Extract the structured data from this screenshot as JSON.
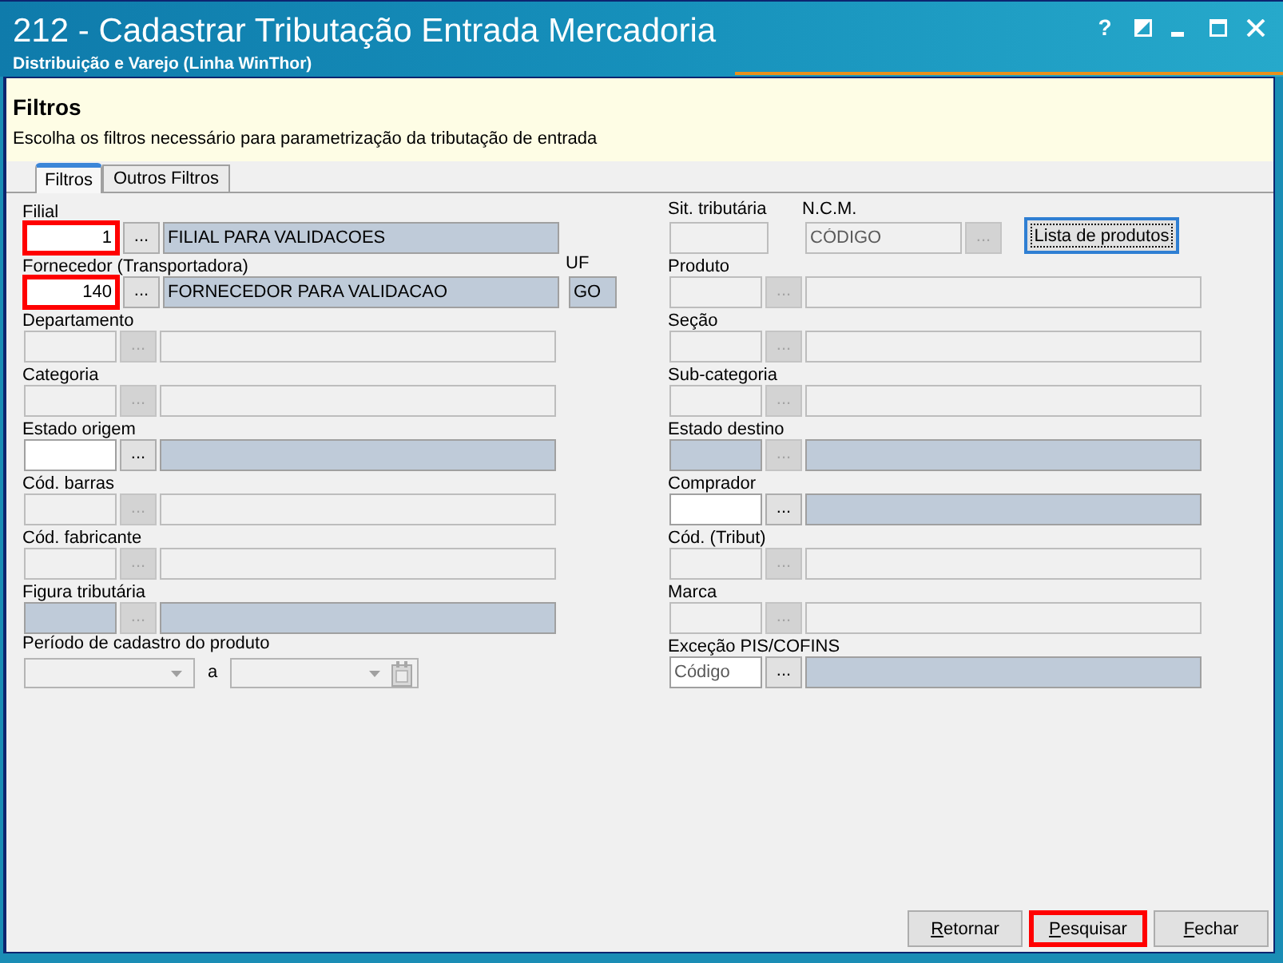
{
  "window": {
    "title": "212 - Cadastrar Tributação Entrada Mercadoria",
    "subtitle": "Distribuição e Varejo (Linha WinThor)",
    "help_button": "?"
  },
  "header": {
    "title": "Filtros",
    "description": "Escolha os filtros necessário para parametrização da tributação de entrada"
  },
  "tabs": [
    {
      "label": "Filtros",
      "selected": true
    },
    {
      "label": "Outros Filtros",
      "selected": false
    }
  ],
  "left_column": [
    {
      "kind": "lookup",
      "label": "Filial",
      "code": {
        "value": "1",
        "readonly": false,
        "disabled": false,
        "highlighted": true
      },
      "button": {
        "label": "...",
        "disabled": false
      },
      "description": {
        "value": "FILIAL PARA VALIDACOES",
        "readonly": true,
        "disabled": false
      }
    },
    {
      "kind": "lookup",
      "label": "Fornecedor (Transportadora)",
      "code": {
        "value": "140",
        "readonly": false,
        "disabled": false,
        "highlighted": true
      },
      "button": {
        "label": "...",
        "disabled": false
      },
      "description": {
        "value": "FORNECEDOR PARA VALIDACAO",
        "readonly": true,
        "disabled": false
      },
      "side_field": {
        "label": "UF",
        "value": "GO",
        "readonly": true,
        "disabled": false
      }
    },
    {
      "kind": "lookup",
      "label": "Departamento",
      "code": {
        "readonly": false,
        "disabled": true,
        "highlighted": false
      },
      "button": {
        "label": "...",
        "disabled": true
      },
      "description": {
        "readonly": false,
        "disabled": true
      }
    },
    {
      "kind": "lookup",
      "label": "Categoria",
      "code": {
        "readonly": false,
        "disabled": true,
        "highlighted": false
      },
      "button": {
        "label": "...",
        "disabled": true
      },
      "description": {
        "readonly": false,
        "disabled": true
      }
    },
    {
      "kind": "lookup",
      "label": "Estado origem",
      "code": {
        "readonly": false,
        "disabled": false,
        "highlighted": false
      },
      "button": {
        "label": "...",
        "disabled": false
      },
      "description": {
        "readonly": true,
        "disabled": false
      }
    },
    {
      "kind": "lookup",
      "label": "Cód. barras",
      "code": {
        "readonly": false,
        "disabled": true,
        "highlighted": false
      },
      "button": {
        "label": "...",
        "disabled": true
      },
      "description": {
        "readonly": false,
        "disabled": true
      }
    },
    {
      "kind": "lookup",
      "label": "Cód. fabricante",
      "code": {
        "readonly": false,
        "disabled": true,
        "highlighted": false
      },
      "button": {
        "label": "...",
        "disabled": true
      },
      "description": {
        "readonly": false,
        "disabled": true
      }
    },
    {
      "kind": "lookup",
      "label": "Figura tributária",
      "code": {
        "readonly": true,
        "disabled": false,
        "highlighted": false
      },
      "button": {
        "label": "...",
        "disabled": true
      },
      "description": {
        "readonly": true,
        "disabled": false
      }
    },
    {
      "kind": "date_range",
      "label": "Período de cadastro do produto",
      "from": {
        "disabled": true
      },
      "separator": "a",
      "to": {
        "disabled": true
      }
    }
  ],
  "right_column": [
    {
      "kind": "tax_ncm",
      "tax_status": {
        "label": "Sit. tributária",
        "readonly": false,
        "disabled": true
      },
      "ncm": {
        "label": "N.C.M.",
        "placeholder": "CÓDIGO",
        "readonly": false,
        "disabled": true,
        "button": {
          "label": "...",
          "disabled": true
        }
      },
      "action_button": {
        "label": "Lista de produtos",
        "focused": true
      }
    },
    {
      "kind": "lookup",
      "label": "Produto",
      "code": {
        "readonly": false,
        "disabled": true,
        "highlighted": false
      },
      "button": {
        "label": "...",
        "disabled": true
      },
      "description": {
        "readonly": false,
        "disabled": true
      }
    },
    {
      "kind": "lookup",
      "label": "Seção",
      "code": {
        "readonly": false,
        "disabled": true,
        "highlighted": false
      },
      "button": {
        "label": "...",
        "disabled": true
      },
      "description": {
        "readonly": false,
        "disabled": true
      }
    },
    {
      "kind": "lookup",
      "label": "Sub-categoria",
      "code": {
        "readonly": false,
        "disabled": true,
        "highlighted": false
      },
      "button": {
        "label": "...",
        "disabled": true
      },
      "description": {
        "readonly": false,
        "disabled": true
      }
    },
    {
      "kind": "lookup",
      "label": "Estado destino",
      "code": {
        "readonly": true,
        "disabled": false,
        "highlighted": false
      },
      "button": {
        "label": "...",
        "disabled": true
      },
      "description": {
        "readonly": true,
        "disabled": false
      }
    },
    {
      "kind": "lookup",
      "label": "Comprador",
      "code": {
        "readonly": false,
        "disabled": false,
        "highlighted": false
      },
      "button": {
        "label": "...",
        "disabled": false
      },
      "description": {
        "readonly": true,
        "disabled": false
      }
    },
    {
      "kind": "lookup",
      "label": "Cód. (Tribut)",
      "code": {
        "readonly": false,
        "disabled": true,
        "highlighted": false
      },
      "button": {
        "label": "...",
        "disabled": true
      },
      "description": {
        "readonly": false,
        "disabled": true
      }
    },
    {
      "kind": "lookup",
      "label": "Marca",
      "code": {
        "readonly": false,
        "disabled": true,
        "highlighted": false
      },
      "button": {
        "label": "...",
        "disabled": true
      },
      "description": {
        "readonly": false,
        "disabled": true
      }
    },
    {
      "kind": "lookup",
      "label": "Exceção PIS/COFINS",
      "code": {
        "placeholder": "Código",
        "readonly": false,
        "disabled": false,
        "highlighted": false
      },
      "button": {
        "label": "...",
        "disabled": false
      },
      "description": {
        "readonly": true,
        "disabled": false
      }
    }
  ],
  "footer_buttons": [
    {
      "label": "Retornar",
      "highlighted": false
    },
    {
      "label": "Pesquisar",
      "highlighted": true
    },
    {
      "label": "Fechar",
      "highlighted": false
    }
  ]
}
